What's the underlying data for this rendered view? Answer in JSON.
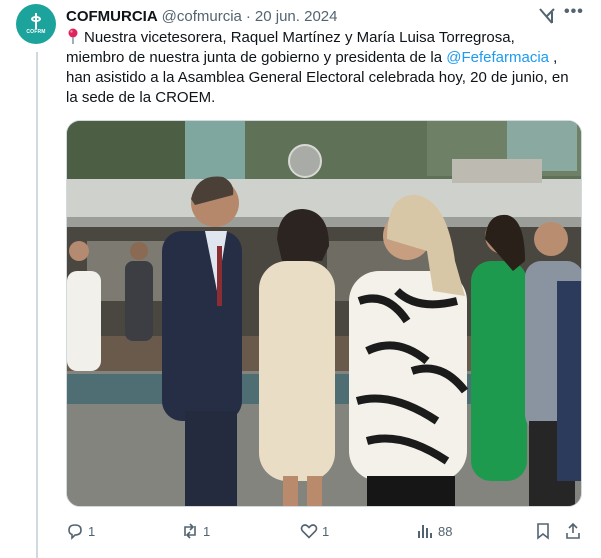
{
  "tweet": {
    "display_name": "COFMURCIA",
    "handle": "@cofmurcia",
    "separator": "·",
    "date": "20 jun. 2024",
    "avatar_text": "COFRM",
    "text_line1": "Nuestra vicetesorera, Raquel Martínez y María Luisa Torregrosa,",
    "text_line2": "miembro de nuestra junta de gobierno y presidenta de la ",
    "mention": "@Fefefarmacia",
    "text_line2_end": " ,",
    "text_line3": "han asistido a la Asamblea General Electoral celebrada hoy, 20 de junio, en",
    "text_line4": "la sede de la CROEM.",
    "pin_icon": "round-pushpin-emoji",
    "more_label": "•••"
  },
  "actions": {
    "replies": "1",
    "reposts": "1",
    "likes": "1",
    "views": "88"
  },
  "colors": {
    "accent": "#1d9bf0",
    "secondary_text": "#536471",
    "avatar_bg": "#1ba39c",
    "jumpsuit_green": "#1e9a4e"
  }
}
